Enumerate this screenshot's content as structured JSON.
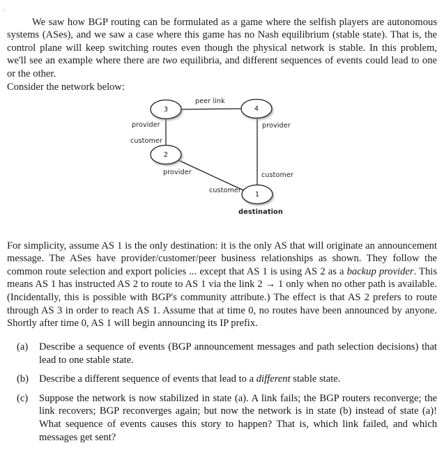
{
  "document": {
    "paragraphs": {
      "intro_a": "We saw how BGP routing can be formulated as a game where the selfish players are autonomous systems (ASes), and we saw a case where this game has no Nash equilibrium (stable state). That is, the control plane will keep switching routes even though the physical network is stable. In this problem, we'll see an example where there are ",
      "intro_em": "two",
      "intro_b": " equilibria, and different sequences of events could lead to one or the other.",
      "consider": "Consider the network below:",
      "setup_a": "For simplicity, assume AS 1 is the only destination: it is the only AS that will originate an announcement message. The ASes have provider/customer/peer business relationships as shown. They follow the common route selection and export policies ... except that AS 1 is using AS 2 as a ",
      "setup_em": "backup provider",
      "setup_b": ". This means AS 1 has instructed AS 2 to route to AS 1 via the link 2 → 1 only when no other path is available. (Incidentally, this is possible with BGP's community attribute.) The effect is that AS 2 prefers to route through AS 3 in order to reach AS 1. Assume that at time 0, no routes have been announced by anyone. Shortly after time 0, AS 1 will begin announcing its IP prefix."
    },
    "questions": [
      {
        "marker": "(a)",
        "text_a": "Describe a sequence of events (BGP announcement messages and path selection decisions) that lead to one stable state.",
        "text_em": "",
        "text_b": ""
      },
      {
        "marker": "(b)",
        "text_a": "Describe a different sequence of events that lead to a ",
        "text_em": "different",
        "text_b": " stable state."
      },
      {
        "marker": "(c)",
        "text_a": "Suppose the network is now stabilized in state (a). A link fails; the BGP routers reconverge; the link recovers; BGP reconverges again; but now the network is in state (b) instead of state (a)! What sequence of events causes this story to happen? That is, which link failed, and which messages get sent?",
        "text_em": "",
        "text_b": ""
      }
    ]
  },
  "diagram": {
    "nodes": [
      {
        "id": "3",
        "label": "3"
      },
      {
        "id": "4",
        "label": "4"
      },
      {
        "id": "2",
        "label": "2"
      },
      {
        "id": "1",
        "label": "1"
      }
    ],
    "edge_labels": {
      "peer_link": "peer link",
      "three_provider": "provider",
      "two_customer": "customer",
      "four_provider": "provider",
      "one_customer_right": "customer",
      "two_provider_low": "provider",
      "one_customer_left": "customer"
    },
    "annotations": {
      "destination": "destination"
    },
    "colors": {
      "stroke": "#1a1a1a",
      "node_fill": "#ffffff",
      "shadow": "#b9b9b9",
      "text": "#1c1c1c"
    }
  }
}
